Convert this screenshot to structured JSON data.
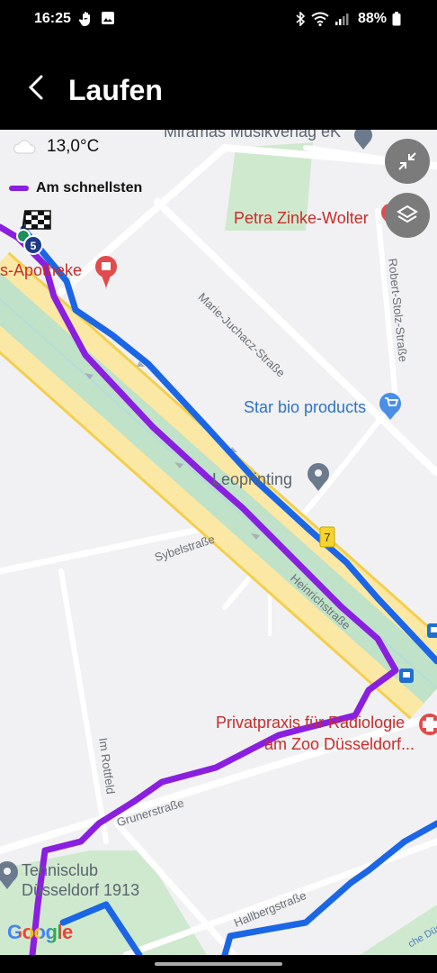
{
  "status": {
    "time": "16:25",
    "battery": "88%"
  },
  "app": {
    "title": "Laufen"
  },
  "weather": {
    "temperature": "13,0°C"
  },
  "legend": {
    "route_label": "Am schnellsten",
    "route_color": "#8a1fe0",
    "track_color": "#1a66e6"
  },
  "markers": {
    "route_number": "5",
    "road_sign": "7"
  },
  "pois": {
    "musikverlag": "Miramas Musikverlag eK",
    "petra": "Petra Zinke-Wolter",
    "apotheke": "s-Apotheke",
    "star_bio": "Star bio products",
    "leoprinting": "Leoprinting",
    "radiologie_line1": "Privatpraxis für Radiologie",
    "radiologie_line2": "am Zoo Düsseldorf...",
    "tennis_line1": "Tennisclub",
    "tennis_line2": "Düsseldorf 1913"
  },
  "streets": {
    "marie": "Marie-Juchacz-Straße",
    "robert": "Robert-Stolz-Straße",
    "sybel": "Sybelstraße",
    "heinrich": "Heinrichstraße",
    "rottfeld": "Im Rottfeld",
    "gruner": "Grunerstraße",
    "hallberg": "Hallbergstraße",
    "corner": "che Düs"
  },
  "attribution": "Google",
  "icons": [
    "back-arrow-icon",
    "collapse-icon",
    "layers-icon",
    "cloud-icon",
    "checkered-flag-icon",
    "pharmacy-pin-icon",
    "shopping-cart-pin-icon",
    "location-pin-icon",
    "medical-pin-icon",
    "bus-stop-icon"
  ]
}
